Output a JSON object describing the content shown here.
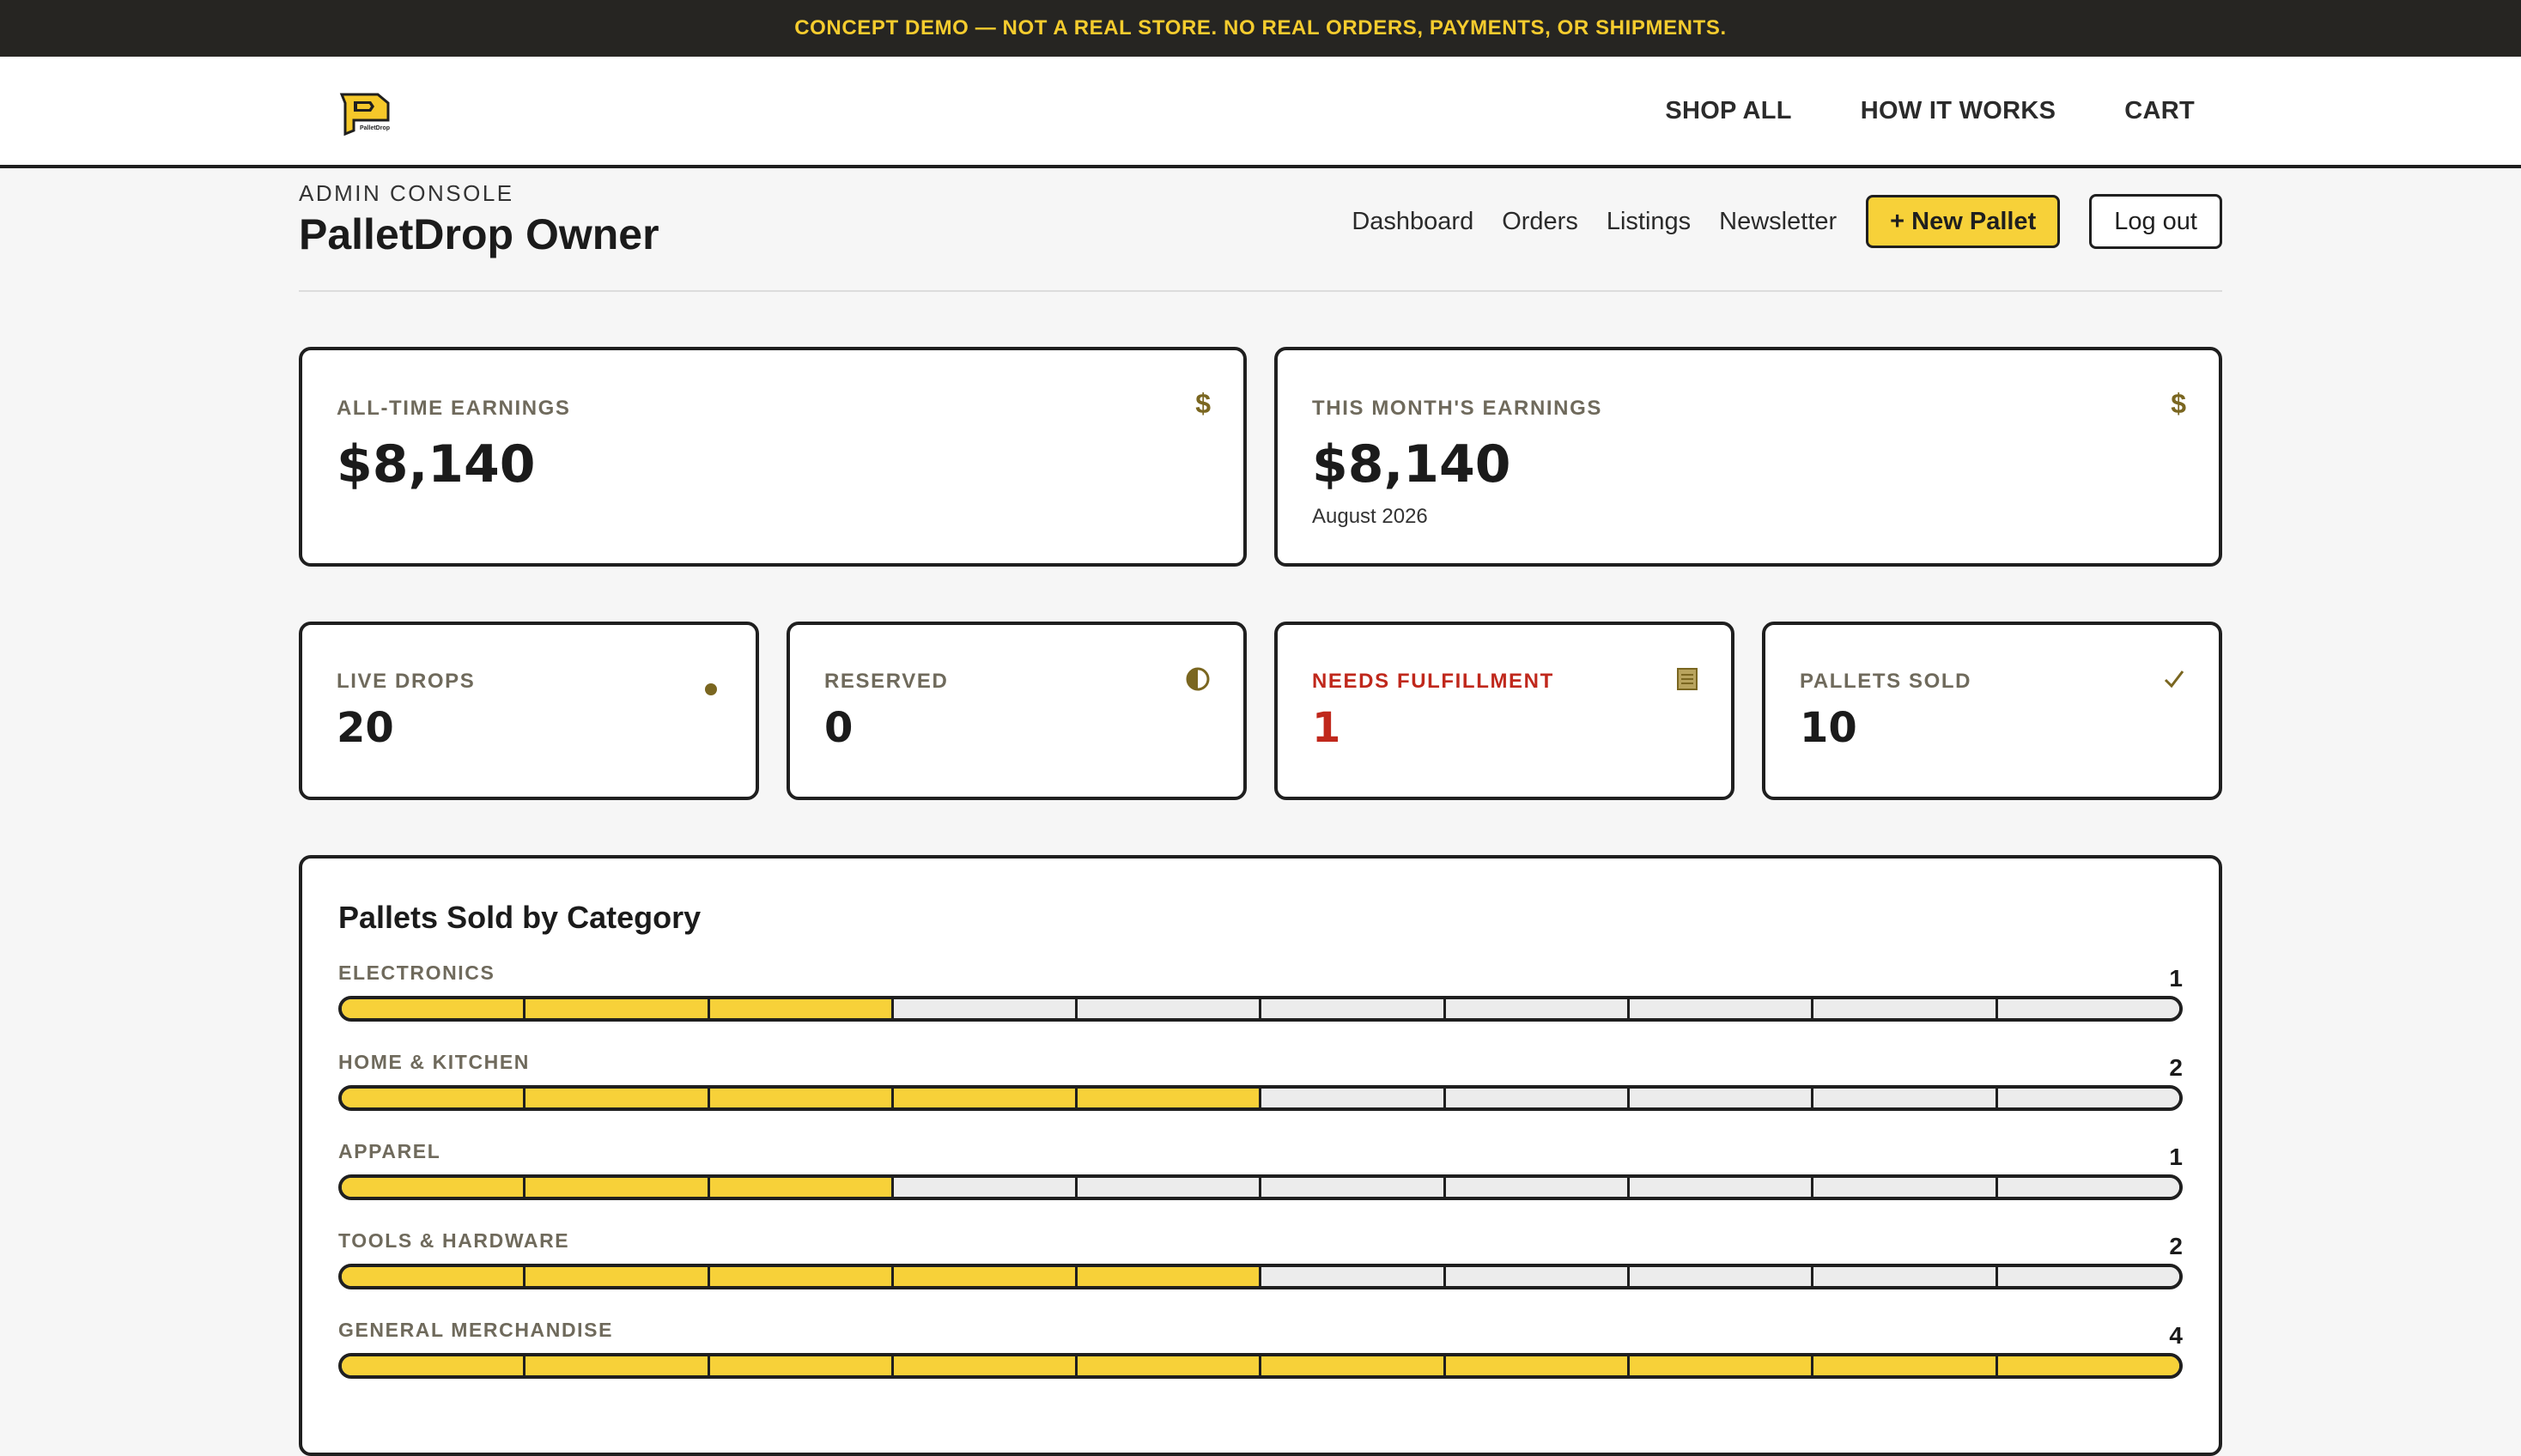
{
  "banner": {
    "text": "CONCEPT DEMO — NOT A REAL STORE. NO REAL ORDERS, PAYMENTS, OR SHIPMENTS."
  },
  "top_nav": {
    "logo_text": "PalletDrop",
    "links": [
      {
        "label": "SHOP ALL"
      },
      {
        "label": "HOW IT WORKS"
      },
      {
        "label": "CART"
      }
    ]
  },
  "admin": {
    "eyebrow": "ADMIN CONSOLE",
    "title": "PalletDrop Owner",
    "nav": [
      {
        "label": "Dashboard"
      },
      {
        "label": "Orders"
      },
      {
        "label": "Listings"
      },
      {
        "label": "Newsletter"
      }
    ],
    "new_pallet_label": "+ New Pallet",
    "logout_label": "Log out"
  },
  "earnings": {
    "all_time": {
      "label": "ALL-TIME EARNINGS",
      "value": "$8,140",
      "icon": "dollar-icon"
    },
    "this_month": {
      "label": "THIS MONTH'S EARNINGS",
      "value": "$8,140",
      "sub": "August 2026",
      "icon": "dollar-icon"
    }
  },
  "stats": [
    {
      "label": "LIVE DROPS",
      "value": "20",
      "icon": "dot-icon"
    },
    {
      "label": "RESERVED",
      "value": "0",
      "icon": "half-circle-icon"
    },
    {
      "label": "NEEDS FULFILLMENT",
      "value": "1",
      "icon": "document-icon",
      "color": "#c0281c"
    },
    {
      "label": "PALLETS SOLD",
      "value": "10",
      "icon": "check-icon"
    }
  ],
  "category_chart": {
    "title": "Pallets Sold by Category",
    "segments_total": 10,
    "accent": "#f7d139",
    "rows": [
      {
        "label": "ELECTRONICS",
        "count": "1",
        "filled_segments": 3
      },
      {
        "label": "HOME & KITCHEN",
        "count": "2",
        "filled_segments": 5
      },
      {
        "label": "APPAREL",
        "count": "1",
        "filled_segments": 3
      },
      {
        "label": "TOOLS & HARDWARE",
        "count": "2",
        "filled_segments": 5
      },
      {
        "label": "GENERAL MERCHANDISE",
        "count": "4",
        "filled_segments": 10
      }
    ]
  }
}
